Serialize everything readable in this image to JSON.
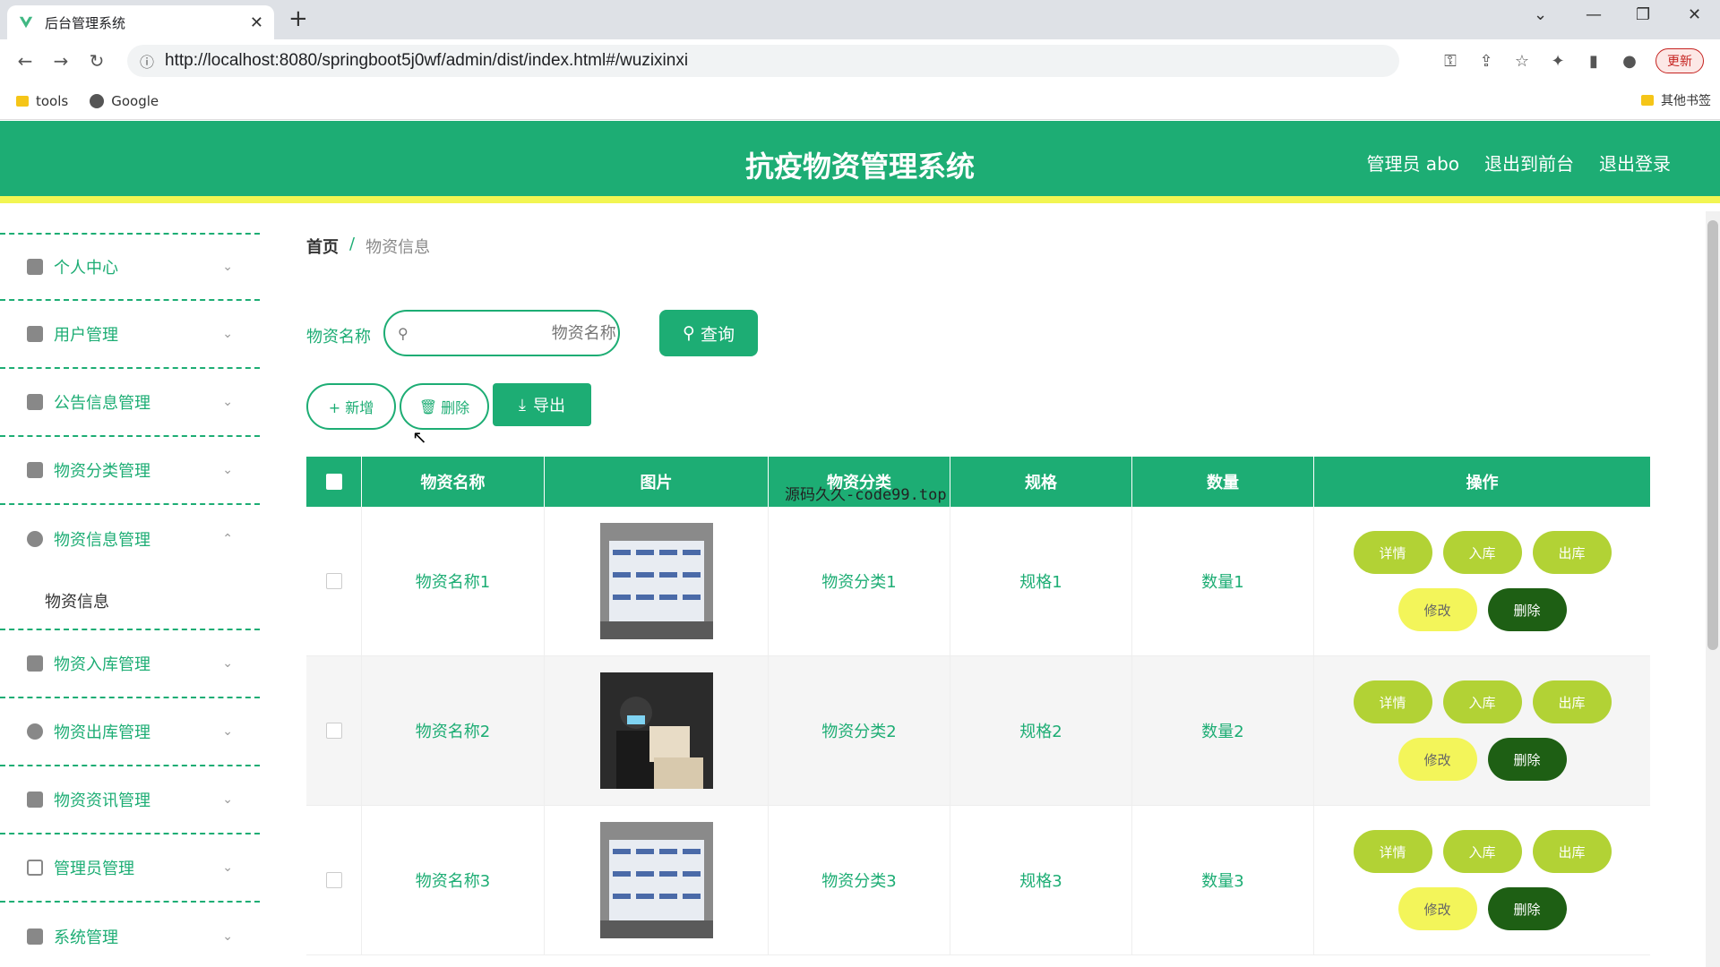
{
  "browser": {
    "tab_title": "后台管理系统",
    "url": "http://localhost:8080/springboot5j0wf/admin/dist/index.html#/wuzixinxi",
    "update_label": "更新",
    "bookmarks": [
      {
        "label": "tools",
        "icon": "folder-icon"
      },
      {
        "label": "Google",
        "icon": "globe-icon"
      }
    ],
    "other_bookmarks": "其他书签"
  },
  "header": {
    "title": "抗疫物资管理系统",
    "links": [
      "管理员 abo",
      "退出到前台",
      "退出登录"
    ]
  },
  "sidebar": {
    "items": [
      {
        "label": "个人中心",
        "icon": "user-icon"
      },
      {
        "label": "用户管理",
        "icon": "users-icon"
      },
      {
        "label": "公告信息管理",
        "icon": "chart-icon"
      },
      {
        "label": "物资分类管理",
        "icon": "user-icon"
      },
      {
        "label": "物资信息管理",
        "icon": "clock-icon",
        "expanded": true,
        "sub": "物资信息"
      },
      {
        "label": "物资入库管理",
        "icon": "check-icon"
      },
      {
        "label": "物资出库管理",
        "icon": "bulb-icon"
      },
      {
        "label": "物资资讯管理",
        "icon": "briefcase-icon"
      },
      {
        "label": "管理员管理",
        "icon": "crop-icon"
      },
      {
        "label": "系统管理",
        "icon": "clipboard-icon"
      }
    ]
  },
  "breadcrumb": {
    "home": "首页",
    "sep": "/",
    "current": "物资信息"
  },
  "search": {
    "label": "物资名称",
    "placeholder": "物资名称",
    "query_label": "查询"
  },
  "actions": {
    "add": "+ 新增",
    "delete": "删除",
    "export": "导出"
  },
  "table": {
    "headers": [
      "物资名称",
      "图片",
      "物资分类",
      "规格",
      "数量",
      "操作"
    ],
    "rows": [
      {
        "name": "物资名称1",
        "category": "物资分类1",
        "spec": "规格1",
        "qty": "数量1"
      },
      {
        "name": "物资名称2",
        "category": "物资分类2",
        "spec": "规格2",
        "qty": "数量2"
      },
      {
        "name": "物资名称3",
        "category": "物资分类3",
        "spec": "规格3",
        "qty": "数量3"
      }
    ],
    "row_ops": {
      "detail": "详情",
      "in": "入库",
      "out": "出库",
      "edit": "修改",
      "delete": "删除"
    }
  },
  "overlay_text": "源码久久-code99.top",
  "colors": {
    "primary": "#1dad74",
    "accent_yellow": "#f2f552",
    "op_green": "#b2d235",
    "op_dark": "#1e5f14"
  }
}
